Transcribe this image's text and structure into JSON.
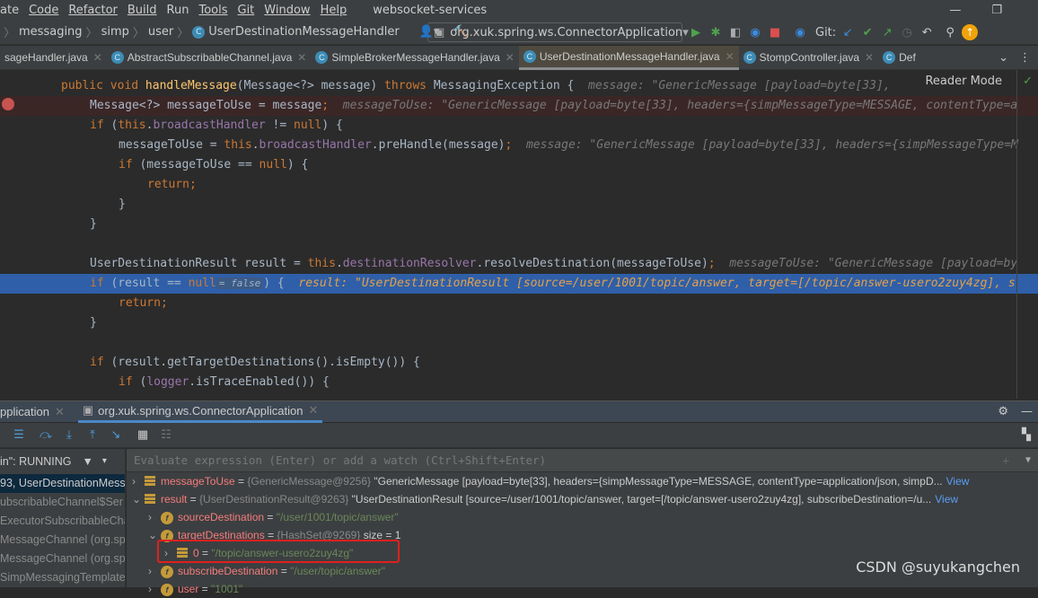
{
  "menu": {
    "items": [
      "ate",
      "Code",
      "Refactor",
      "Build",
      "Run",
      "Tools",
      "Git",
      "Window",
      "Help"
    ],
    "project_title": "websocket-services"
  },
  "breadcrumb": [
    "messaging",
    "simp",
    "user",
    "UserDestinationMessageHandler"
  ],
  "run_config": "org.xuk.spring.ws.ConnectorApplication",
  "git_label": "Git:",
  "tabs": [
    {
      "label": "sageHandler.java",
      "active": false
    },
    {
      "label": "AbstractSubscribableChannel.java",
      "active": false
    },
    {
      "label": "SimpleBrokerMessageHandler.java",
      "active": false
    },
    {
      "label": "UserDestinationMessageHandler.java",
      "active": true
    },
    {
      "label": "StompController.java",
      "active": false
    },
    {
      "label": "Def",
      "active": false
    }
  ],
  "reader_mode": "Reader Mode",
  "code": [
    {
      "indent": 1,
      "state": "",
      "tokens": [
        [
          "k",
          "public void "
        ],
        [
          "m",
          "handleMessage"
        ],
        [
          "",
          "(Message<?> message) "
        ],
        [
          "k",
          "throws "
        ],
        [
          "",
          "MessagingException {"
        ]
      ],
      "hint": "message: \"GenericMessage [payload=byte[33],"
    },
    {
      "indent": 2,
      "state": "bp",
      "tokens": [
        [
          "",
          "Message<?> messageToUse = message"
        ],
        [
          "k",
          ";"
        ]
      ],
      "hint": "messageToUse: \"GenericMessage [payload=byte[33], headers={simpMessageType=MESSAGE, contentType=a"
    },
    {
      "indent": 2,
      "state": "",
      "tokens": [
        [
          "k",
          "if "
        ],
        [
          "",
          "("
        ],
        [
          "k",
          "this"
        ],
        [
          "",
          "."
        ],
        [
          "f",
          "broadcastHandler"
        ],
        [
          "",
          " != "
        ],
        [
          "k",
          "null"
        ],
        [
          "",
          ") {"
        ]
      ],
      "hint": ""
    },
    {
      "indent": 3,
      "state": "",
      "tokens": [
        [
          "",
          "messageToUse = "
        ],
        [
          "k",
          "this"
        ],
        [
          "",
          "."
        ],
        [
          "f",
          "broadcastHandler"
        ],
        [
          "",
          ".preHandle(message)"
        ],
        [
          "k",
          ";"
        ]
      ],
      "hint": "message: \"GenericMessage [payload=byte[33], headers={simpMessageType=M"
    },
    {
      "indent": 3,
      "state": "",
      "tokens": [
        [
          "k",
          "if "
        ],
        [
          "",
          "(messageToUse == "
        ],
        [
          "k",
          "null"
        ],
        [
          "",
          ") {"
        ]
      ],
      "hint": ""
    },
    {
      "indent": 4,
      "state": "",
      "tokens": [
        [
          "k",
          "return;"
        ]
      ],
      "hint": ""
    },
    {
      "indent": 3,
      "state": "",
      "tokens": [
        [
          "",
          "}"
        ]
      ],
      "hint": ""
    },
    {
      "indent": 2,
      "state": "",
      "tokens": [
        [
          "",
          "}"
        ]
      ],
      "hint": ""
    },
    {
      "indent": 0,
      "state": "",
      "tokens": [],
      "hint": ""
    },
    {
      "indent": 2,
      "state": "",
      "tokens": [
        [
          "",
          "UserDestinationResult result = "
        ],
        [
          "k",
          "this"
        ],
        [
          "",
          "."
        ],
        [
          "f",
          "destinationResolver"
        ],
        [
          "",
          ".resolveDestination(messageToUse)"
        ],
        [
          "k",
          ";"
        ]
      ],
      "hint": "messageToUse: \"GenericMessage [payload=by"
    },
    {
      "indent": 2,
      "state": "cur",
      "tokens": [
        [
          "k",
          "if "
        ],
        [
          "",
          "(result == "
        ],
        [
          "k",
          "null"
        ]
      ],
      "inline": "= false",
      "tokens2": [
        [
          "",
          ") {"
        ]
      ],
      "hint": "result: \"UserDestinationResult [source=/user/1001/topic/answer, target=[/topic/answer-usero2zuy4zg], s"
    },
    {
      "indent": 3,
      "state": "",
      "tokens": [
        [
          "k",
          "return;"
        ]
      ],
      "hint": ""
    },
    {
      "indent": 2,
      "state": "",
      "tokens": [
        [
          "",
          "}"
        ]
      ],
      "hint": ""
    },
    {
      "indent": 0,
      "state": "",
      "tokens": [],
      "hint": ""
    },
    {
      "indent": 2,
      "state": "",
      "tokens": [
        [
          "k",
          "if "
        ],
        [
          "",
          "(result.getTargetDestinations().isEmpty()) {"
        ]
      ],
      "hint": ""
    },
    {
      "indent": 3,
      "state": "",
      "tokens": [
        [
          "k",
          "if "
        ],
        [
          "",
          "("
        ],
        [
          "f",
          "logger"
        ],
        [
          "",
          ".isTraceEnabled()) {"
        ]
      ],
      "hint": ""
    }
  ],
  "debug": {
    "tabs": [
      {
        "label": "pplication",
        "active": false
      },
      {
        "label": "org.xuk.spring.ws.ConnectorApplication",
        "active": true
      }
    ],
    "thread_status": "in\": RUNNING",
    "frames": [
      {
        "label": "93, UserDestinationMess",
        "selected": true
      },
      {
        "label": "ubscribableChannel$Ser",
        "selected": false
      },
      {
        "label": "ExecutorSubscribableCha",
        "selected": false
      },
      {
        "label": "MessageChannel (org.sp",
        "selected": false
      },
      {
        "label": "MessageChannel (org.sp",
        "selected": false
      },
      {
        "label": "SimpMessagingTemplate",
        "selected": false
      }
    ],
    "eval_placeholder": "Evaluate expression (Enter) or add a watch (Ctrl+Shift+Enter)",
    "variables": [
      {
        "level": 0,
        "expanded": false,
        "icon": "list",
        "name": "messageToUse",
        "type": "{GenericMessage@9256}",
        "value": "\"GenericMessage [payload=byte[33], headers={simpMessageType=MESSAGE, contentType=application/json, simpD...",
        "view": "View"
      },
      {
        "level": 0,
        "expanded": true,
        "icon": "list",
        "name": "result",
        "type": "{UserDestinationResult@9263}",
        "value": "\"UserDestinationResult [source=/user/1001/topic/answer, target=[/topic/answer-usero2zuy4zg], subscribeDestination=/u...",
        "view": "View"
      },
      {
        "level": 1,
        "expanded": false,
        "icon": "field",
        "name": "sourceDestination",
        "type": "",
        "value": "\"/user/1001/topic/answer\"",
        "view": ""
      },
      {
        "level": 1,
        "expanded": true,
        "icon": "field",
        "name": "targetDestinations",
        "type": "{HashSet@9269}",
        "value": "size = 1",
        "view": ""
      },
      {
        "level": 2,
        "expanded": false,
        "icon": "list",
        "name": "0",
        "type": "",
        "value": "\"/topic/answer-usero2zuy4zg\"",
        "view": ""
      },
      {
        "level": 1,
        "expanded": false,
        "icon": "field",
        "name": "subscribeDestination",
        "type": "",
        "value": "\"/user/topic/answer\"",
        "view": ""
      },
      {
        "level": 1,
        "expanded": false,
        "icon": "field",
        "name": "user",
        "type": "",
        "value": "\"1001\"",
        "view": ""
      }
    ]
  },
  "watermark": "CSDN @suyukangchen",
  "colors": {
    "keyword": "#cc7832",
    "method": "#ffc66d",
    "field": "#9876aa",
    "highlight": "#e0201e",
    "current_line": "#2f5fa8"
  }
}
